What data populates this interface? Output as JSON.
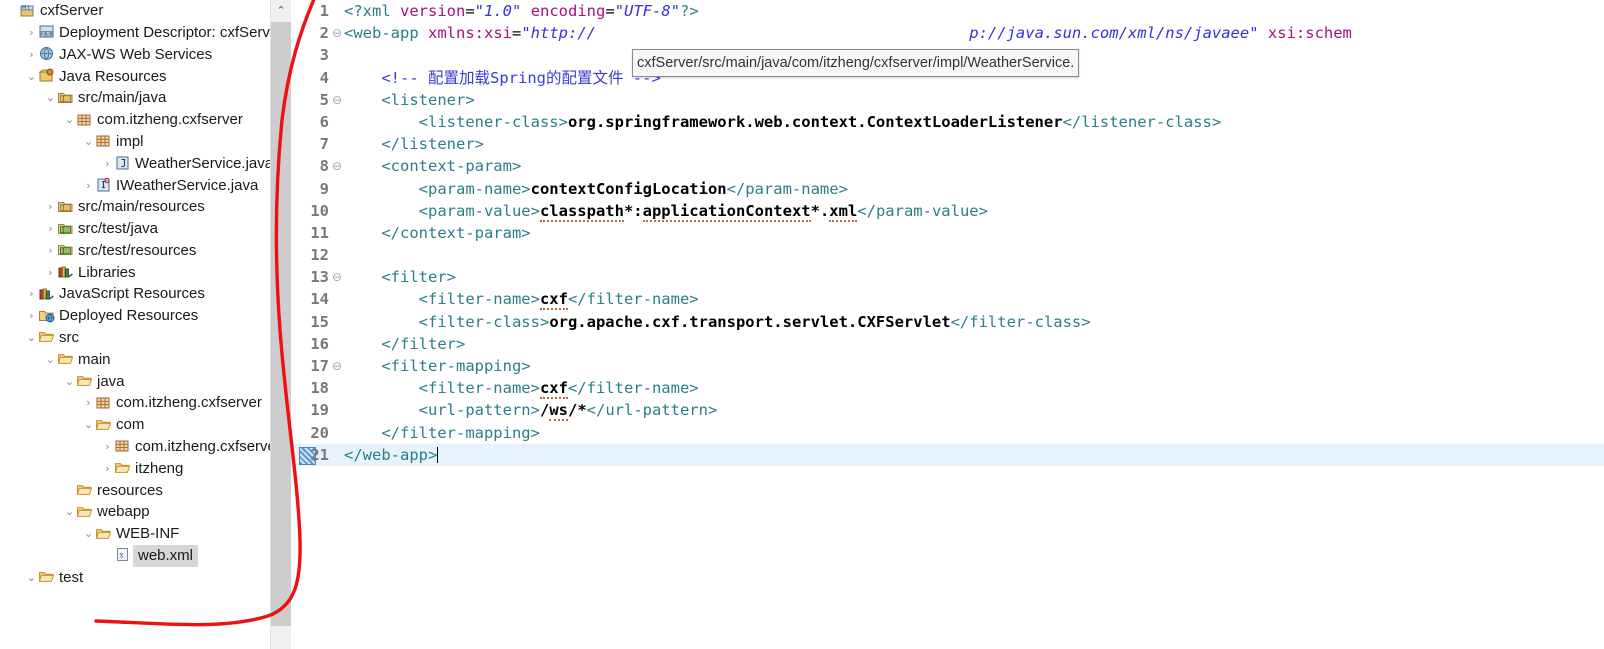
{
  "explorer": {
    "name": "Project Explorer",
    "items": [
      {
        "label": "cxfServer",
        "depth": 0,
        "arrow": "",
        "icon": "project-icon",
        "selected": false
      },
      {
        "label": "Deployment Descriptor: cxfServe",
        "depth": 1,
        "arrow": "›",
        "icon": "deployment-descriptor-icon",
        "selected": false
      },
      {
        "label": "JAX-WS Web Services",
        "depth": 1,
        "arrow": "›",
        "icon": "jaxws-icon",
        "selected": false
      },
      {
        "label": "Java Resources",
        "depth": 1,
        "arrow": "⌄",
        "icon": "java-resources-icon",
        "selected": false
      },
      {
        "label": "src/main/java",
        "depth": 2,
        "arrow": "⌄",
        "icon": "source-folder-icon",
        "selected": false
      },
      {
        "label": "com.itzheng.cxfserver",
        "depth": 3,
        "arrow": "⌄",
        "icon": "package-icon",
        "selected": false
      },
      {
        "label": "impl",
        "depth": 4,
        "arrow": "⌄",
        "icon": "package-icon",
        "selected": false
      },
      {
        "label": "WeatherService.java",
        "depth": 5,
        "arrow": "›",
        "icon": "java-class-icon",
        "selected": false
      },
      {
        "label": "IWeatherService.java",
        "depth": 4,
        "arrow": "›",
        "icon": "java-interface-icon",
        "selected": false
      },
      {
        "label": "src/main/resources",
        "depth": 2,
        "arrow": "›",
        "icon": "source-folder-icon",
        "selected": false
      },
      {
        "label": "src/test/java",
        "depth": 2,
        "arrow": "›",
        "icon": "source-folder-green-icon",
        "selected": false
      },
      {
        "label": "src/test/resources",
        "depth": 2,
        "arrow": "›",
        "icon": "source-folder-green-icon",
        "selected": false
      },
      {
        "label": "Libraries",
        "depth": 2,
        "arrow": "›",
        "icon": "libraries-icon",
        "selected": false
      },
      {
        "label": "JavaScript Resources",
        "depth": 1,
        "arrow": "›",
        "icon": "libraries-icon",
        "selected": false
      },
      {
        "label": "Deployed Resources",
        "depth": 1,
        "arrow": "›",
        "icon": "deployed-resources-icon",
        "selected": false
      },
      {
        "label": "src",
        "depth": 1,
        "arrow": "⌄",
        "icon": "folder-icon",
        "selected": false
      },
      {
        "label": "main",
        "depth": 2,
        "arrow": "⌄",
        "icon": "folder-icon",
        "selected": false
      },
      {
        "label": "java",
        "depth": 3,
        "arrow": "⌄",
        "icon": "folder-icon",
        "selected": false
      },
      {
        "label": "com.itzheng.cxfserver",
        "depth": 4,
        "arrow": "›",
        "icon": "package-icon",
        "selected": false
      },
      {
        "label": "com",
        "depth": 4,
        "arrow": "⌄",
        "icon": "folder-icon",
        "selected": false
      },
      {
        "label": "com.itzheng.cxfserver",
        "depth": 5,
        "arrow": "›",
        "icon": "package-icon",
        "selected": false
      },
      {
        "label": "itzheng",
        "depth": 5,
        "arrow": "›",
        "icon": "folder-icon",
        "selected": false
      },
      {
        "label": "resources",
        "depth": 3,
        "arrow": "",
        "icon": "folder-icon",
        "selected": false
      },
      {
        "label": "webapp",
        "depth": 3,
        "arrow": "⌄",
        "icon": "folder-icon",
        "selected": false
      },
      {
        "label": "WEB-INF",
        "depth": 4,
        "arrow": "⌄",
        "icon": "folder-icon",
        "selected": false
      },
      {
        "label": "web.xml",
        "depth": 5,
        "arrow": "",
        "icon": "xml-file-icon",
        "selected": true
      },
      {
        "label": "test",
        "depth": 1,
        "arrow": "⌄",
        "icon": "folder-icon",
        "selected": false
      }
    ],
    "scroll_up_glyph": "⌃"
  },
  "tooltip": {
    "text": "cxfServer/src/main/java/com/itzheng/cxfserver/impl/WeatherService."
  },
  "editor": {
    "file": "web.xml",
    "cursor_line": 21,
    "lines": [
      {
        "n": "1",
        "fold": "",
        "segments": [
          {
            "t": "t",
            "v": "<?xml "
          },
          {
            "t": "a",
            "v": "version"
          },
          {
            "t": "eq",
            "v": "="
          },
          {
            "t": "s",
            "v": "\"1.0\""
          },
          {
            "t": "eq",
            "v": " "
          },
          {
            "t": "a",
            "v": "encoding"
          },
          {
            "t": "eq",
            "v": "="
          },
          {
            "t": "s",
            "v": "\"UTF-8\""
          },
          {
            "t": "t",
            "v": "?>"
          }
        ]
      },
      {
        "n": "2",
        "fold": "⊖",
        "segments": [
          {
            "t": "t",
            "v": "<web-app "
          },
          {
            "t": "a",
            "v": "xmlns:xsi"
          },
          {
            "t": "eq",
            "v": "="
          },
          {
            "t": "s",
            "v": "\"http://                                        p://java.sun.com/xml/ns/javaee\""
          },
          {
            "t": "eq",
            "v": " "
          },
          {
            "t": "a",
            "v": "xsi:schem"
          }
        ]
      },
      {
        "n": "3",
        "fold": "",
        "segments": []
      },
      {
        "n": "4",
        "fold": "",
        "segments": [
          {
            "t": "c",
            "v": "    <!-- 配置加载Spring的配置文件 -->"
          }
        ]
      },
      {
        "n": "5",
        "fold": "⊖",
        "segments": [
          {
            "t": "t",
            "v": "    <listener>"
          }
        ]
      },
      {
        "n": "6",
        "fold": "",
        "segments": [
          {
            "t": "t",
            "v": "        <listener-class>"
          },
          {
            "t": "x",
            "v": "org.springframework.web.context.ContextLoaderListener"
          },
          {
            "t": "t",
            "v": "</listener-class>"
          }
        ]
      },
      {
        "n": "7",
        "fold": "",
        "segments": [
          {
            "t": "t",
            "v": "    </listener>"
          }
        ]
      },
      {
        "n": "8",
        "fold": "⊖",
        "segments": [
          {
            "t": "t",
            "v": "    <context-param>"
          }
        ]
      },
      {
        "n": "9",
        "fold": "",
        "segments": [
          {
            "t": "t",
            "v": "        <param-name>"
          },
          {
            "t": "x",
            "v": "contextConfigLocation"
          },
          {
            "t": "t",
            "v": "</param-name>"
          }
        ]
      },
      {
        "n": "10",
        "fold": "",
        "segments": [
          {
            "t": "t",
            "v": "        <param-value>"
          },
          {
            "t": "xsq",
            "v": "classpath"
          },
          {
            "t": "x",
            "v": "*:"
          },
          {
            "t": "xsq",
            "v": "applicationContext"
          },
          {
            "t": "x",
            "v": "*."
          },
          {
            "t": "xsq",
            "v": "xml"
          },
          {
            "t": "t",
            "v": "</param-value>"
          }
        ]
      },
      {
        "n": "11",
        "fold": "",
        "segments": [
          {
            "t": "t",
            "v": "    </context-param>"
          }
        ]
      },
      {
        "n": "12",
        "fold": "",
        "segments": []
      },
      {
        "n": "13",
        "fold": "⊖",
        "segments": [
          {
            "t": "t",
            "v": "    <filter>"
          }
        ]
      },
      {
        "n": "14",
        "fold": "",
        "segments": [
          {
            "t": "t",
            "v": "        <filter-name>"
          },
          {
            "t": "xsq",
            "v": "cxf"
          },
          {
            "t": "t",
            "v": "</filter-name>"
          }
        ]
      },
      {
        "n": "15",
        "fold": "",
        "segments": [
          {
            "t": "t",
            "v": "        <filter-class>"
          },
          {
            "t": "x",
            "v": "org.apache.cxf.transport.servlet.CXFServlet"
          },
          {
            "t": "t",
            "v": "</filter-class>"
          }
        ]
      },
      {
        "n": "16",
        "fold": "",
        "segments": [
          {
            "t": "t",
            "v": "    </filter>"
          }
        ]
      },
      {
        "n": "17",
        "fold": "⊖",
        "segments": [
          {
            "t": "t",
            "v": "    <filter-mapping>"
          }
        ]
      },
      {
        "n": "18",
        "fold": "",
        "segments": [
          {
            "t": "t",
            "v": "        <filter-name>"
          },
          {
            "t": "xsq",
            "v": "cxf"
          },
          {
            "t": "t",
            "v": "</filter-name>"
          }
        ]
      },
      {
        "n": "19",
        "fold": "",
        "segments": [
          {
            "t": "t",
            "v": "        <url-pattern>"
          },
          {
            "t": "x",
            "v": "/"
          },
          {
            "t": "xsq",
            "v": "ws"
          },
          {
            "t": "x",
            "v": "/*"
          },
          {
            "t": "t",
            "v": "</url-pattern>"
          }
        ]
      },
      {
        "n": "20",
        "fold": "",
        "segments": [
          {
            "t": "t",
            "v": "    </filter-mapping>"
          }
        ]
      },
      {
        "n": "21",
        "fold": "",
        "segments": [
          {
            "t": "t",
            "v": "</web-app>"
          },
          {
            "t": "caret",
            "v": ""
          }
        ]
      }
    ]
  },
  "annotation": {
    "color": "#ee1111",
    "shape": "hand-drawn-curve-from-top-right-to-web-xml"
  }
}
